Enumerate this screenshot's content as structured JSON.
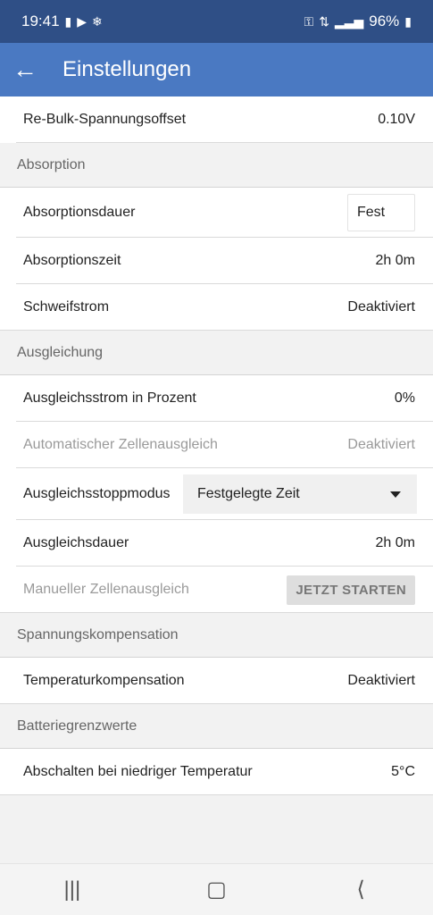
{
  "status": {
    "time": "19:41",
    "battery": "96%",
    "left_icons": [
      "message-icon",
      "youtube-icon",
      "snowflake-icon"
    ],
    "right_icons": [
      "key-icon",
      "4g-icon",
      "signal-icon",
      "battery-icon"
    ]
  },
  "appbar": {
    "title": "Einstellungen"
  },
  "rows": {
    "rebulk": {
      "label": "Re-Bulk-Spannungsoffset",
      "value": "0.10V"
    },
    "absorption_section": "Absorption",
    "abs_duration": {
      "label": "Absorptionsdauer",
      "value": "Fest"
    },
    "abs_time": {
      "label": "Absorptionszeit",
      "value": "2h 0m"
    },
    "tail": {
      "label": "Schweifstrom",
      "value": "Deaktiviert"
    },
    "equal_section": "Ausgleichung",
    "eq_current": {
      "label": "Ausgleichsstrom in Prozent",
      "value": "0%"
    },
    "auto_balance": {
      "label": "Automatischer Zellenausgleich",
      "value": "Deaktiviert"
    },
    "eq_stop": {
      "label": "Ausgleichsstoppmodus",
      "value": "Festgelegte Zeit"
    },
    "eq_duration": {
      "label": "Ausgleichsdauer",
      "value": "2h 0m"
    },
    "manual_balance": {
      "label": "Manueller Zellenausgleich",
      "button": "JETZT STARTEN"
    },
    "comp_section": "Spannungskompensation",
    "temp_comp": {
      "label": "Temperaturkompensation",
      "value": "Deaktiviert"
    },
    "limits_section": "Batteriegrenzwerte",
    "low_temp": {
      "label": "Abschalten bei niedriger Temperatur",
      "value": "5°C"
    }
  }
}
